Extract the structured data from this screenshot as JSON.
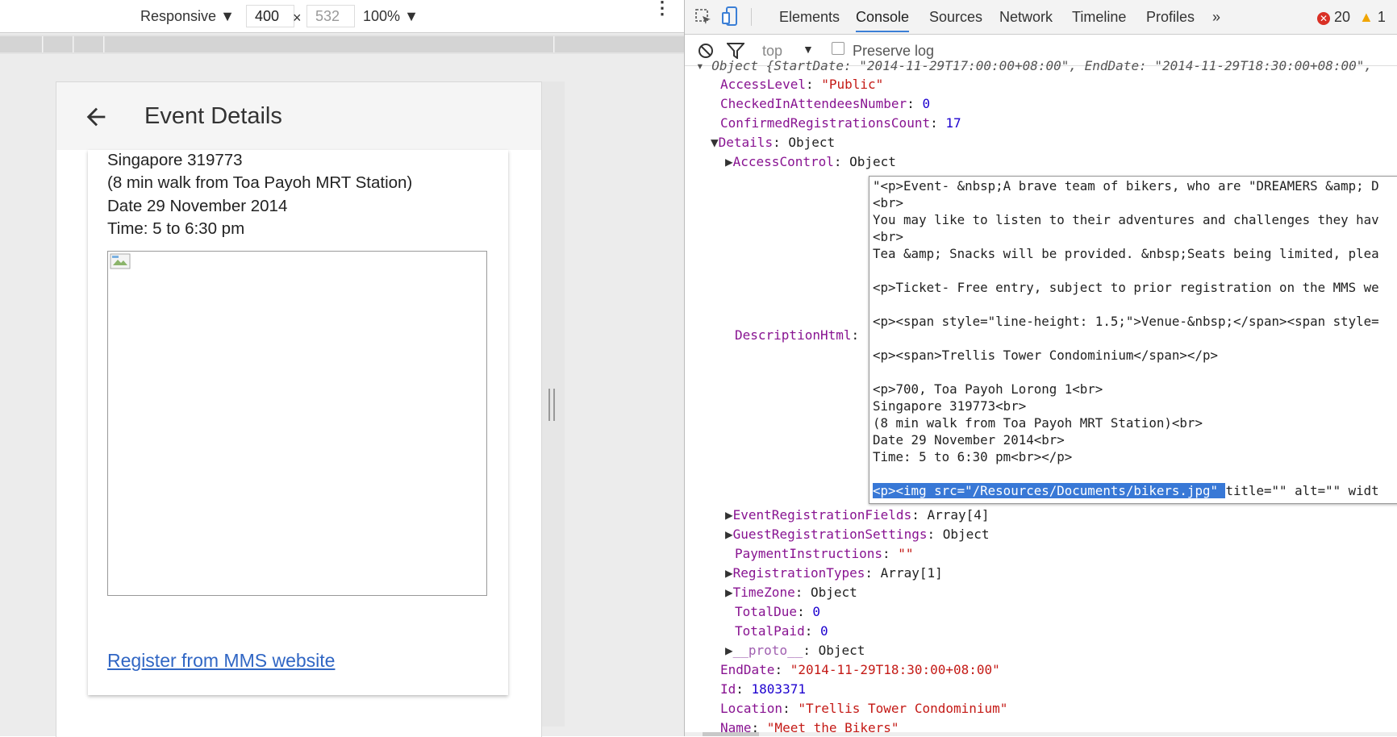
{
  "device_toolbar": {
    "mode": "Responsive",
    "width": "400",
    "times": "×",
    "height": "532",
    "zoom": "100%"
  },
  "app": {
    "title": "Event Details",
    "lines": [
      "Singapore 319773",
      "(8 min walk from Toa Payoh MRT Station)",
      "Date 29 November 2014",
      "Time: 5 to 6:30 pm"
    ],
    "link": "Register from MMS website"
  },
  "devtools": {
    "tabs": [
      "Elements",
      "Console",
      "Sources",
      "Network",
      "Timeline",
      "Profiles"
    ],
    "more": "»",
    "errors": "20",
    "warnings": "1",
    "context": "top",
    "preserve_log": "Preserve log"
  },
  "console": {
    "top_line": "Object {StartDate: \"2014-11-29T17:00:00+08:00\", EndDate: \"2014-11-29T18:30:00+08:00\",",
    "access_level": {
      "key": "AccessLevel",
      "value": "\"Public\""
    },
    "checked_in": {
      "key": "CheckedInAttendeesNumber",
      "value": "0"
    },
    "confirmed": {
      "key": "ConfirmedRegistrationsCount",
      "value": "17"
    },
    "details": {
      "key": "Details",
      "value": "Object"
    },
    "access_control": {
      "key": "AccessControl",
      "value": "Object"
    },
    "description_key": "DescriptionHtml",
    "description_lines": [
      "\"<p>Event- &nbsp;A brave team of bikers, who are \"DREAMERS &amp; D",
      "<br>",
      "You may like to listen to their adventures and challenges they hav",
      "<br>",
      "Tea &amp; Snacks will be provided. &nbsp;Seats being limited, plea",
      "",
      "<p>Ticket- Free entry, subject to prior registration on the MMS we",
      "",
      "<p><span style=\"line-height: 1.5;\">Venue-&nbsp;</span><span style=",
      "",
      "<p><span>Trellis Tower Condominium</span></p>",
      "",
      "<p>700, Toa Payoh Lorong 1<br>",
      "Singapore 319773<br>",
      "(8 min walk from Toa Payoh MRT Station)<br>",
      "Date 29 November 2014<br>",
      "Time: 5 to 6:30 pm<br></p>",
      ""
    ],
    "description_selected": "<p><img src=\"/Resources/Documents/bikers.jpg\" ",
    "description_rest": "title=\"\" alt=\"\" widt",
    "event_reg_fields": {
      "key": "EventRegistrationFields",
      "value": "Array[4]"
    },
    "guest_reg": {
      "key": "GuestRegistrationSettings",
      "value": "Object"
    },
    "payment": {
      "key": "PaymentInstructions",
      "value": "\"\""
    },
    "reg_types": {
      "key": "RegistrationTypes",
      "value": "Array[1]"
    },
    "timezone": {
      "key": "TimeZone",
      "value": "Object"
    },
    "total_due": {
      "key": "TotalDue",
      "value": "0"
    },
    "total_paid": {
      "key": "TotalPaid",
      "value": "0"
    },
    "proto": {
      "key": "__proto__",
      "value": "Object"
    },
    "end_date": {
      "key": "EndDate",
      "value": "\"2014-11-29T18:30:00+08:00\""
    },
    "id": {
      "key": "Id",
      "value": "1803371"
    },
    "location": {
      "key": "Location",
      "value": "\"Trellis Tower Condominium\""
    },
    "name": {
      "key": "Name",
      "value": "\"Meet the Bikers\""
    }
  }
}
